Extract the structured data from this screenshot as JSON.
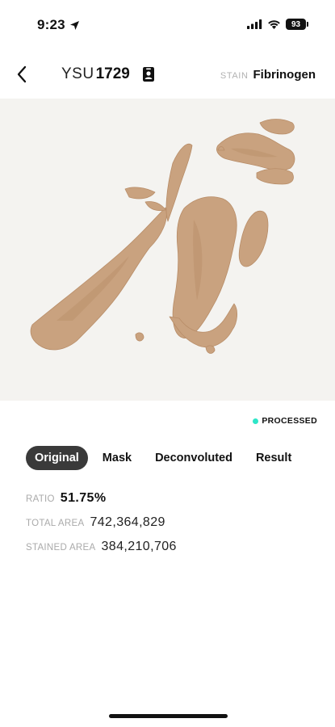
{
  "status_bar": {
    "time": "9:23",
    "battery": "93"
  },
  "header": {
    "title_prefix": "YSU",
    "title_number": "1729",
    "stain_label": "STAIN",
    "stain_value": "Fibrinogen"
  },
  "status": {
    "text": "PROCESSED",
    "color": "#2ee6c8"
  },
  "tabs": [
    {
      "label": "Original",
      "active": true
    },
    {
      "label": "Mask",
      "active": false
    },
    {
      "label": "Deconvoluted",
      "active": false
    },
    {
      "label": "Result",
      "active": false
    }
  ],
  "stats": [
    {
      "label": "RATIO",
      "value": "51.75%"
    },
    {
      "label": "TOTAL AREA",
      "value": "742,364,829"
    },
    {
      "label": "STAINED AREA",
      "value": "384,210,706"
    }
  ],
  "colors": {
    "tissue": "#c9a27f",
    "tissue_dark": "#b88d68",
    "slide_bg": "#f4f3f0",
    "active_tab": "#3a3a3a"
  },
  "icons": {
    "back": "chevron-left-icon",
    "badge": "id-badge-icon",
    "location": "location-arrow-icon",
    "signal": "cellular-signal-icon",
    "wifi": "wifi-icon",
    "battery": "battery-icon"
  }
}
